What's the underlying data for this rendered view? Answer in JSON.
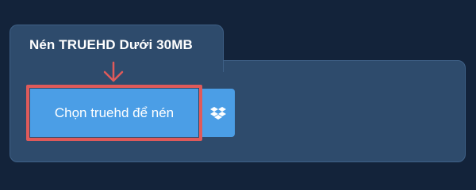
{
  "panel": {
    "tab_title": "Nén TRUEHD Dưới 30MB",
    "choose_button_label": "Chọn truehd để nén",
    "dropbox_icon": "dropbox-icon",
    "annotation_arrow_icon": "down-arrow-icon"
  },
  "colors": {
    "background": "#13233a",
    "panel": "#2e4b6c",
    "button": "#4b9ee6",
    "highlight": "#df5a5a"
  }
}
